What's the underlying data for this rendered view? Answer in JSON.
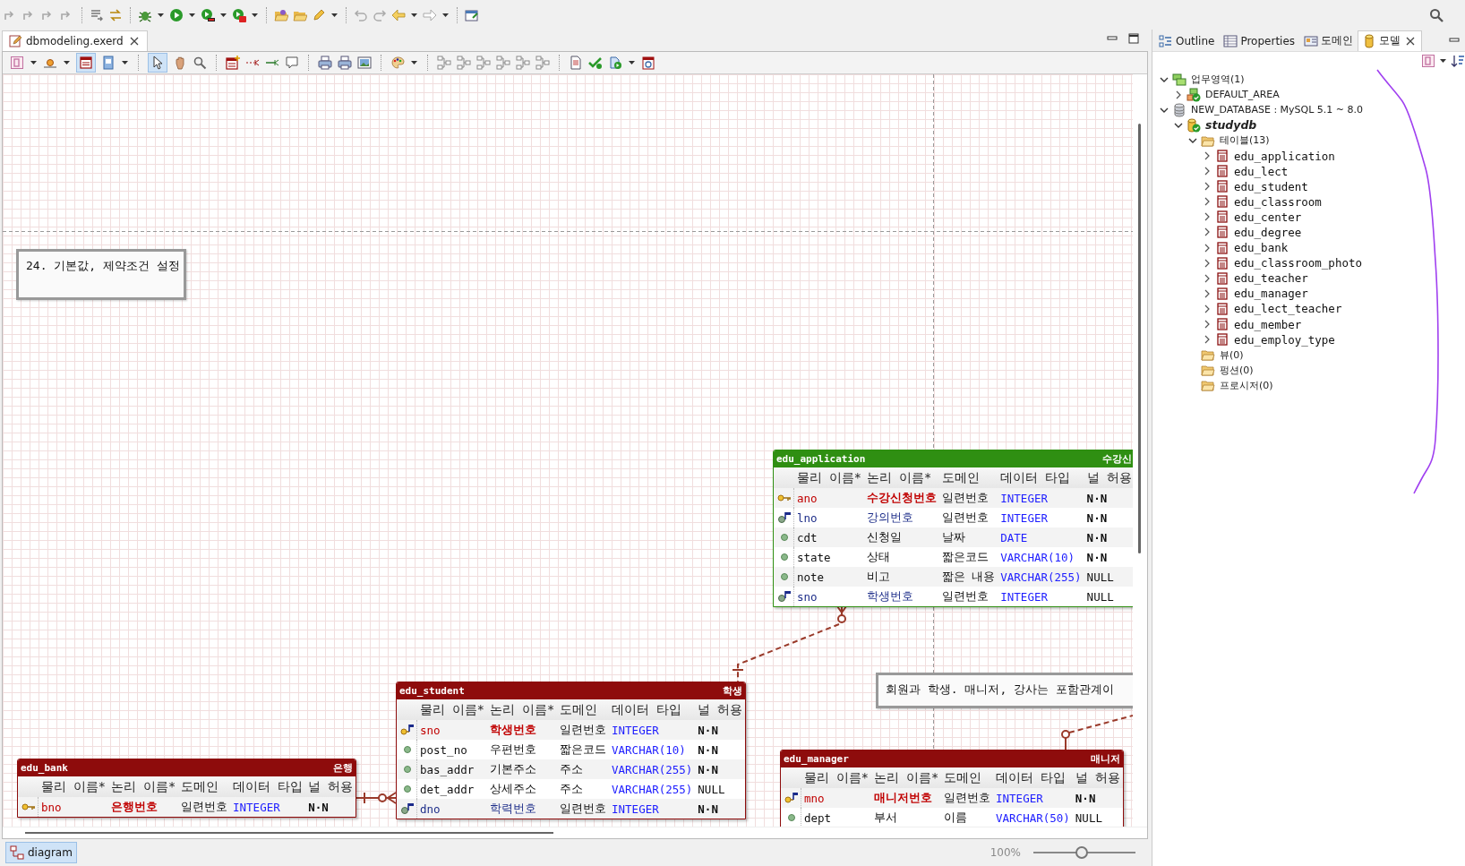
{
  "editor": {
    "tabs": [
      {
        "label": "dbmodeling.exerd"
      }
    ]
  },
  "diagram": {
    "notes": [
      {
        "text": "24. 기본값, 제약조건 설정"
      },
      {
        "text": "회원과 학생. 매니저, 강사는 포함관계이"
      }
    ],
    "tables": [
      {
        "name": "edu_application",
        "label": "수강신",
        "color": "#2f8f12",
        "columns": [
          "물리 이름*",
          "논리 이름*",
          "도메인",
          "데이터 타입",
          "널 허용"
        ],
        "rows": [
          {
            "kind": "pk",
            "physical": "ano",
            "logical": "수강신청번호",
            "domain": "일련번호",
            "type": "INTEGER",
            "nullable": "N·N",
            "not_null": true
          },
          {
            "kind": "fk",
            "physical": "lno",
            "logical": "강의번호",
            "domain": "일련번호",
            "type": "INTEGER",
            "nullable": "N·N",
            "not_null": true
          },
          {
            "kind": "column",
            "physical": "cdt",
            "logical": "신청일",
            "domain": "날짜",
            "type": "DATE",
            "nullable": "N·N",
            "not_null": true
          },
          {
            "kind": "column",
            "physical": "state",
            "logical": "상태",
            "domain": "짧은코드",
            "type": "VARCHAR(10)",
            "nullable": "N·N",
            "not_null": true
          },
          {
            "kind": "column",
            "physical": "note",
            "logical": "비고",
            "domain": "짧은 내용",
            "type": "VARCHAR(255)",
            "nullable": "NULL",
            "not_null": false
          },
          {
            "kind": "fk",
            "physical": "sno",
            "logical": "학생번호",
            "domain": "일련번호",
            "type": "INTEGER",
            "nullable": "NULL",
            "not_null": false
          }
        ]
      },
      {
        "name": "edu_bank",
        "label": "은행",
        "color": "#8e0c0c",
        "columns": [
          "물리 이름*",
          "논리 이름*",
          "도메인",
          "데이터 타입",
          "널 허용"
        ],
        "rows": [
          {
            "kind": "pk",
            "physical": "bno",
            "logical": "은행번호",
            "domain": "일련번호",
            "type": "INTEGER",
            "nullable": "N·N",
            "not_null": true
          }
        ]
      },
      {
        "name": "edu_student",
        "label": "학생",
        "color": "#8e0c0c",
        "columns": [
          "물리 이름*",
          "논리 이름*",
          "도메인",
          "데이터 타입",
          "널 허용"
        ],
        "rows": [
          {
            "kind": "pfk",
            "physical": "sno",
            "logical": "학생번호",
            "domain": "일련번호",
            "type": "INTEGER",
            "nullable": "N·N",
            "not_null": true
          },
          {
            "kind": "column",
            "physical": "post_no",
            "logical": "우편번호",
            "domain": "짧은코드",
            "type": "VARCHAR(10)",
            "nullable": "N·N",
            "not_null": true
          },
          {
            "kind": "column",
            "physical": "bas_addr",
            "logical": "기본주소",
            "domain": "주소",
            "type": "VARCHAR(255)",
            "nullable": "N·N",
            "not_null": true
          },
          {
            "kind": "column",
            "physical": "det_addr",
            "logical": "상세주소",
            "domain": "주소",
            "type": "VARCHAR(255)",
            "nullable": "NULL",
            "not_null": false
          },
          {
            "kind": "fk",
            "physical": "dno",
            "logical": "학력번호",
            "domain": "일련번호",
            "type": "INTEGER",
            "nullable": "N·N",
            "not_null": true
          }
        ]
      },
      {
        "name": "edu_manager",
        "label": "매니저",
        "color": "#8e0c0c",
        "columns": [
          "물리 이름*",
          "논리 이름*",
          "도메인",
          "데이터 타입",
          "널 허용"
        ],
        "rows": [
          {
            "kind": "pfk",
            "physical": "mno",
            "logical": "매니저번호",
            "domain": "일련번호",
            "type": "INTEGER",
            "nullable": "N·N",
            "not_null": true
          },
          {
            "kind": "column",
            "physical": "dept",
            "logical": "부서",
            "domain": "이름",
            "type": "VARCHAR(50)",
            "nullable": "NULL",
            "not_null": false
          }
        ]
      }
    ]
  },
  "bottom_tabs": [
    {
      "label": "diagram",
      "selected": true
    }
  ],
  "zoom": {
    "reading": "100%",
    "level": 0.47
  },
  "side_panel": {
    "tabs": [
      {
        "label": "Outline",
        "kind": "outline",
        "selected": false
      },
      {
        "label": "Properties",
        "kind": "properties",
        "selected": false
      },
      {
        "label": "도메인",
        "kind": "domain",
        "selected": false
      },
      {
        "label": "모델",
        "kind": "model",
        "selected": true
      }
    ],
    "tree": [
      {
        "label": "업무영역(1)",
        "kind": "area",
        "expanded": true,
        "children": [
          {
            "label": "DEFAULT_AREA",
            "kind": "area-item",
            "expanded": false
          }
        ]
      },
      {
        "label": "NEW_DATABASE : MySQL 5.1 ~ 8.0",
        "kind": "database",
        "expanded": true,
        "children": [
          {
            "label": "studydb",
            "kind": "schema",
            "expanded": true,
            "children": [
              {
                "label": "테이블(13)",
                "kind": "folder",
                "expanded": true,
                "children": [
                  {
                    "label": "edu_application",
                    "kind": "table",
                    "expanded": false
                  },
                  {
                    "label": "edu_lect",
                    "kind": "table",
                    "expanded": false
                  },
                  {
                    "label": "edu_student",
                    "kind": "table",
                    "expanded": false
                  },
                  {
                    "label": "edu_classroom",
                    "kind": "table",
                    "expanded": false
                  },
                  {
                    "label": "edu_center",
                    "kind": "table",
                    "expanded": false
                  },
                  {
                    "label": "edu_degree",
                    "kind": "table",
                    "expanded": false
                  },
                  {
                    "label": "edu_bank",
                    "kind": "table",
                    "expanded": false
                  },
                  {
                    "label": "edu_classroom_photo",
                    "kind": "table",
                    "expanded": false
                  },
                  {
                    "label": "edu_teacher",
                    "kind": "table",
                    "expanded": false
                  },
                  {
                    "label": "edu_manager",
                    "kind": "table",
                    "expanded": false
                  },
                  {
                    "label": "edu_lect_teacher",
                    "kind": "table",
                    "expanded": false
                  },
                  {
                    "label": "edu_member",
                    "kind": "table",
                    "expanded": false
                  },
                  {
                    "label": "edu_employ_type",
                    "kind": "table",
                    "expanded": false
                  }
                ]
              },
              {
                "label": "뷰(0)",
                "kind": "folder"
              },
              {
                "label": "펑션(0)",
                "kind": "folder"
              },
              {
                "label": "프로시저(0)",
                "kind": "folder"
              }
            ]
          }
        ]
      }
    ]
  }
}
